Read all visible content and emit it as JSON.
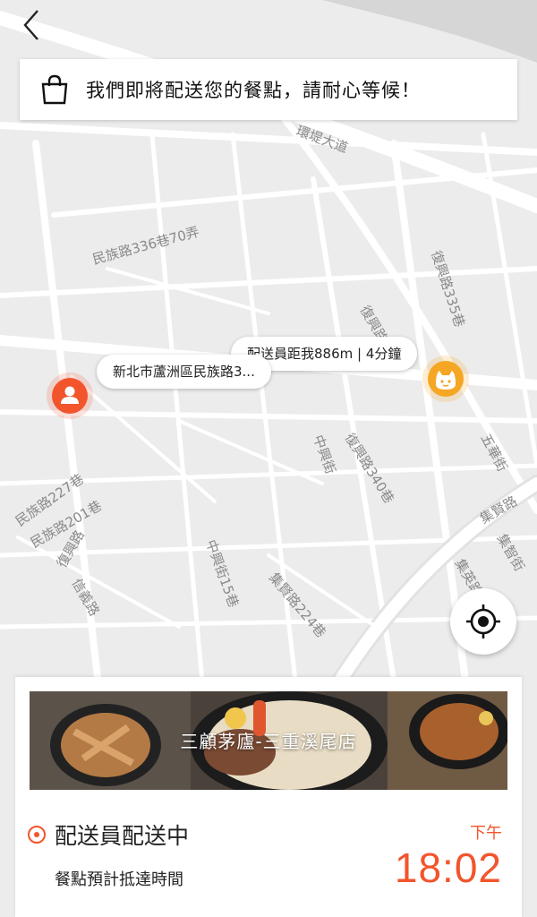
{
  "banner": {
    "message": "我們即將配送您的餐點，請耐心等候！",
    "icon": "shopping-bag-icon"
  },
  "map": {
    "road_labels": [
      "環堤大道",
      "民族路336巷70弄",
      "復興路335巷",
      "復興路",
      "中興街",
      "復興路340巷",
      "五華街",
      "民族路227巷",
      "民族路201巷",
      "復興路",
      "信義路",
      "中興街15巷",
      "集賢路224巷",
      "集賢路",
      "集智街",
      "集英路"
    ],
    "courier_bubble": "配送員距我886m | 4分鐘",
    "address_bubble": "新北市蘆洲區民族路3..."
  },
  "card": {
    "store_name": "三顧茅廬-三重溪尾店",
    "status": "配送員配送中",
    "eta_label": "餐點預計抵達時間",
    "ampm": "下午",
    "eta_time": "18:02"
  },
  "colors": {
    "accent": "#f2552c",
    "courier_pin": "#f5a623",
    "map_bg": "#ececec",
    "road": "#ffffff"
  }
}
